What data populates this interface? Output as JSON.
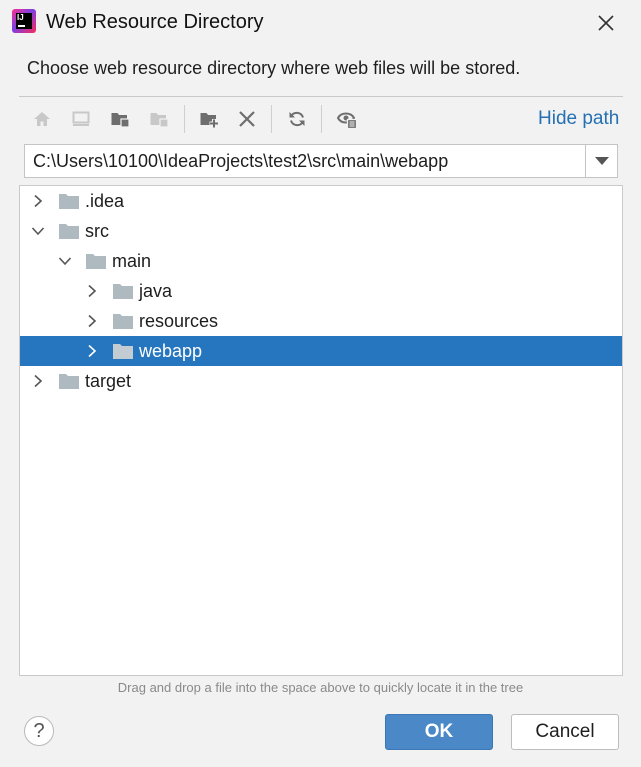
{
  "window": {
    "title": "Web Resource Directory",
    "logo_text": "IJ"
  },
  "description": "Choose web resource directory where web files will be stored.",
  "toolbar": {
    "buttons": [
      "home-icon",
      "desktop-icon",
      "project-folder-icon",
      "module-folder-icon",
      "new-folder-icon",
      "delete-icon",
      "refresh-icon",
      "show-hidden-icon"
    ],
    "hide_path_label": "Hide path"
  },
  "path": {
    "value": "C:\\Users\\10100\\IdeaProjects\\test2\\src\\main\\webapp"
  },
  "tree": {
    "items": [
      {
        "label": ".idea",
        "expanded": false,
        "selected": false
      },
      {
        "label": "src",
        "expanded": true,
        "selected": false
      },
      {
        "label": "main",
        "expanded": true,
        "selected": false
      },
      {
        "label": "java",
        "expanded": false,
        "selected": false
      },
      {
        "label": "resources",
        "expanded": false,
        "selected": false
      },
      {
        "label": "webapp",
        "expanded": false,
        "selected": true
      },
      {
        "label": "target",
        "expanded": false,
        "selected": false
      }
    ]
  },
  "hint": "Drag and drop a file into the space above to quickly locate it in the tree",
  "footer": {
    "help_label": "?",
    "ok_label": "OK",
    "cancel_label": "Cancel"
  },
  "colors": {
    "selection": "#2675bf",
    "link": "#2470b3",
    "primary_button": "#4a88c7",
    "folder": "#aeb9c0"
  }
}
